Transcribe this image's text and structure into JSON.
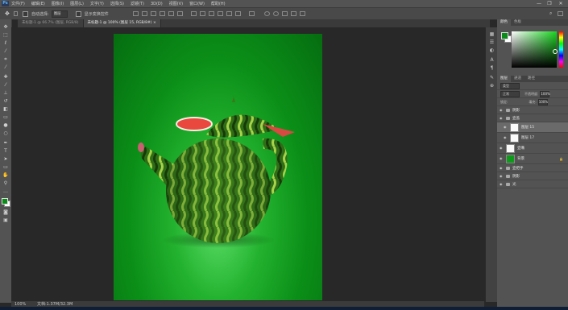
{
  "menubar": {
    "app_logo": "Ps",
    "items": [
      "文件(F)",
      "编辑(E)",
      "图像(I)",
      "图层(L)",
      "文字(Y)",
      "选择(S)",
      "滤镜(T)",
      "3D(D)",
      "视图(V)",
      "窗口(W)",
      "帮助(H)"
    ],
    "controls": [
      "—",
      "❐",
      "✕"
    ]
  },
  "options_bar": {
    "auto_select_label": "自动选择:",
    "auto_select_value": "图层",
    "transform_controls_label": "显示变换控件"
  },
  "tabs": [
    {
      "label": "未标题-1 @ 66.7% (图层, RGB/8)",
      "active": false
    },
    {
      "label": "未标题-1 @ 100% (图层 15, RGB/8#) ×",
      "active": true
    }
  ],
  "status": {
    "zoom": "100%",
    "doc_info": "文档:1.37M/32.3M"
  },
  "panels": {
    "color_tabs": [
      "颜色",
      "色板"
    ],
    "layers_tabs": [
      "图层",
      "通道",
      "路径"
    ],
    "kind_filter": "类型",
    "blend_mode": "正常",
    "opacity_label": "不透明度:",
    "opacity_value": "100%",
    "lock_label": "锁定:",
    "fill_label": "填充:",
    "fill_value": "100%",
    "layers": [
      {
        "name": "阴影",
        "type": "folder",
        "selected": false
      },
      {
        "name": "壶盖",
        "type": "folder",
        "selected": false
      },
      {
        "name": "图层 15",
        "type": "layer",
        "selected": true
      },
      {
        "name": "图层 17",
        "type": "layer",
        "selected": false
      },
      {
        "name": "壶嘴",
        "type": "layer",
        "selected": false
      },
      {
        "name": "背景",
        "type": "layer-green",
        "selected": false
      },
      {
        "name": "壶把手",
        "type": "folder",
        "selected": false
      },
      {
        "name": "阴影",
        "type": "folder",
        "selected": false
      },
      {
        "name": "光",
        "type": "folder",
        "selected": false
      }
    ]
  },
  "colors": {
    "foreground": "#0a8c18",
    "background": "#ffffff",
    "canvas_bg": "#0b8f18"
  }
}
